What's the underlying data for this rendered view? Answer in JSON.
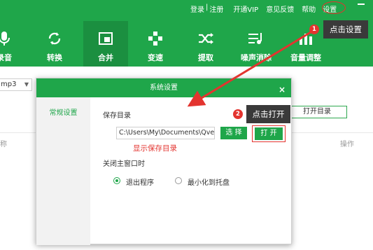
{
  "top_links": {
    "login": "登录",
    "divider": "|",
    "register": "注册",
    "vip": "开通VIP",
    "feedback": "意见反馈",
    "help": "帮助",
    "settings": "设置"
  },
  "nav": [
    {
      "label": "录音",
      "icon": "microphone-icon"
    },
    {
      "label": "转换",
      "icon": "convert-icon"
    },
    {
      "label": "合并",
      "icon": "merge-icon",
      "active": true
    },
    {
      "label": "变速",
      "icon": "speed-icon"
    },
    {
      "label": "提取",
      "icon": "extract-icon"
    },
    {
      "label": "噪声消除",
      "icon": "noise-reduction-icon"
    },
    {
      "label": "音量调整",
      "icon": "volume-adjust-icon"
    }
  ],
  "background": {
    "format_value": "mp3",
    "open_dir_button": "打开目录",
    "col_name": "称",
    "col_operation": "操作"
  },
  "dialog": {
    "title": "系统设置",
    "close": "×",
    "side_tab": "常规设置",
    "save_dir_label": "保存目录",
    "path_value": "C:\\Users\\My\\Documents\\Qve",
    "choose_button": "选 择",
    "open_button": "打 开",
    "show_dir_hint": "显示保存目录",
    "on_close_label": "关闭主窗口时",
    "radio_exit": "退出程序",
    "radio_minimize": "最小化到托盘",
    "selected_radio": "exit"
  },
  "annotations": {
    "step1_num": "1",
    "step1_text": "点击设置",
    "step2_num": "2",
    "step2_text": "点击打开"
  },
  "colors": {
    "brand_green": "#1fa64a",
    "annotation_red": "#e3342f",
    "callout_dark": "#3a3a3a"
  }
}
